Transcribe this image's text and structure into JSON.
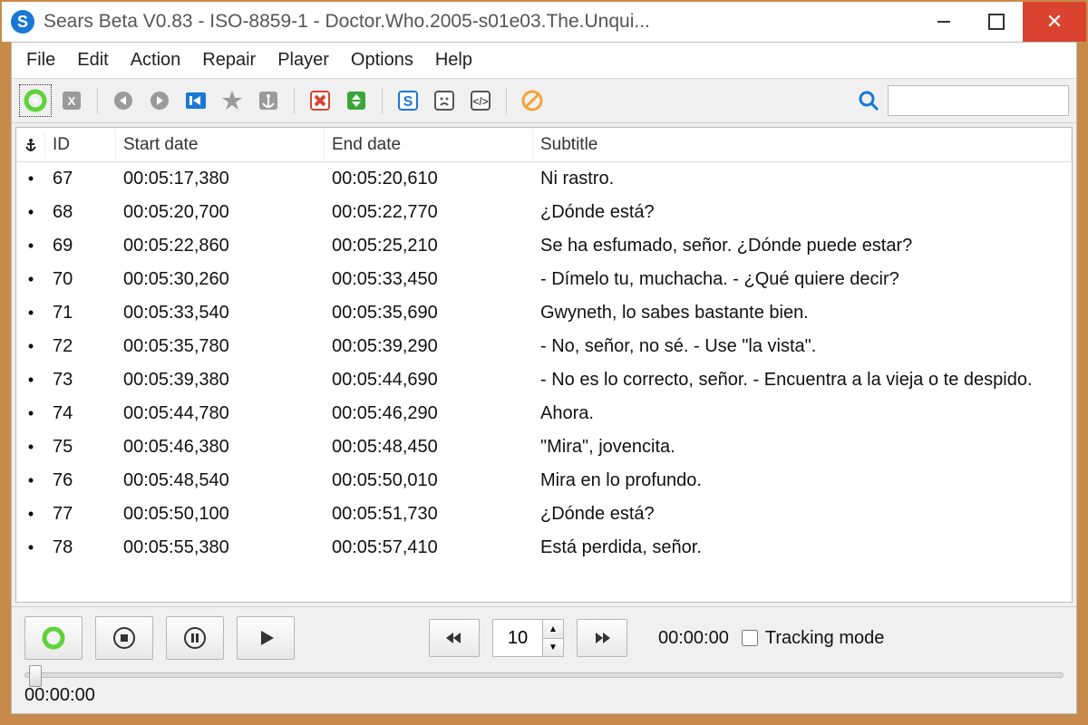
{
  "title": "Sears Beta V0.83 - ISO-8859-1 - Doctor.Who.2005-s01e03.The.Unqui...",
  "app_icon_letter": "S",
  "menus": [
    "File",
    "Edit",
    "Action",
    "Repair",
    "Player",
    "Options",
    "Help"
  ],
  "toolbar_icons": [
    "record-icon",
    "fx-icon",
    "sep",
    "prev-dot-icon",
    "next-dot-icon",
    "export-icon",
    "star-icon",
    "anchor-box-icon",
    "sep",
    "delete-x-icon",
    "merge-icon",
    "sep",
    "s-logo-icon",
    "sad-face-icon",
    "code-tag-icon",
    "sep",
    "clear-circle-icon"
  ],
  "search": {
    "placeholder": ""
  },
  "columns": {
    "anchor": "⚓",
    "id": "ID",
    "start": "Start date",
    "end": "End date",
    "subtitle": "Subtitle"
  },
  "rows": [
    {
      "id": "67",
      "start": "00:05:17,380",
      "end": "00:05:20,610",
      "sub": "Ni rastro."
    },
    {
      "id": "68",
      "start": "00:05:20,700",
      "end": "00:05:22,770",
      "sub": "¿Dónde está?"
    },
    {
      "id": "69",
      "start": "00:05:22,860",
      "end": "00:05:25,210",
      "sub": "Se ha esfumado, señor. ¿Dónde puede estar?"
    },
    {
      "id": "70",
      "start": "00:05:30,260",
      "end": "00:05:33,450",
      "sub": "- Dímelo tu, muchacha. - ¿Qué quiere decir?"
    },
    {
      "id": "71",
      "start": "00:05:33,540",
      "end": "00:05:35,690",
      "sub": "Gwyneth, lo sabes bastante bien."
    },
    {
      "id": "72",
      "start": "00:05:35,780",
      "end": "00:05:39,290",
      "sub": "- No, señor, no sé. - Use \"la vista\"."
    },
    {
      "id": "73",
      "start": "00:05:39,380",
      "end": "00:05:44,690",
      "sub": "- No es lo correcto, señor. - Encuentra a la vieja o te despido."
    },
    {
      "id": "74",
      "start": "00:05:44,780",
      "end": "00:05:46,290",
      "sub": "Ahora."
    },
    {
      "id": "75",
      "start": "00:05:46,380",
      "end": "00:05:48,450",
      "sub": "\"Mira\", jovencita."
    },
    {
      "id": "76",
      "start": "00:05:48,540",
      "end": "00:05:50,010",
      "sub": "Mira en lo profundo."
    },
    {
      "id": "77",
      "start": "00:05:50,100",
      "end": "00:05:51,730",
      "sub": "¿Dónde está?"
    },
    {
      "id": "78",
      "start": "00:05:55,380",
      "end": "00:05:57,410",
      "sub": "Está perdida, señor."
    }
  ],
  "player": {
    "step_value": "10",
    "time_display": "00:00:00",
    "tracking_label": "Tracking mode",
    "seek_time": "00:00:00"
  }
}
